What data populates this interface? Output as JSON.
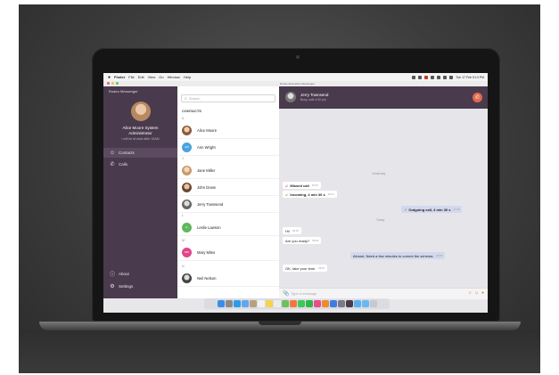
{
  "menubar": {
    "items": [
      "Finder",
      "File",
      "Edit",
      "View",
      "Go",
      "Window",
      "Help"
    ],
    "clock": "Tue 17 Feb  5:13 PM"
  },
  "window": {
    "title": "Rodeo Enterprise Messenger"
  },
  "sidebar": {
    "app_name": "Rodeo Messenger",
    "user_name_line1": "Alice Moore System",
    "user_name_line2": "Administrator",
    "user_status": "I will be at work after 10AM",
    "nav": [
      {
        "label": "Contacts",
        "icon": "person-icon"
      },
      {
        "label": "Calls",
        "icon": "phone-icon"
      }
    ],
    "bottom": [
      {
        "label": "About",
        "icon": "info-icon"
      },
      {
        "label": "Settings",
        "icon": "gear-icon"
      }
    ]
  },
  "contacts": {
    "search_placeholder": "Search",
    "header": "CONTACTS",
    "groups": [
      {
        "letter": "A",
        "items": [
          {
            "name": "Alice Moore"
          },
          {
            "name": "Ann Wright",
            "initials": "AW"
          }
        ]
      },
      {
        "letter": "J",
        "items": [
          {
            "name": "Jane Miller"
          },
          {
            "name": "John Doew"
          },
          {
            "name": "Jerry Townsend"
          }
        ]
      },
      {
        "letter": "L",
        "items": [
          {
            "name": "Leslie Lawson",
            "initials": "LL"
          }
        ]
      },
      {
        "letter": "M",
        "items": [
          {
            "name": "Mary Miles",
            "initials": "MM"
          }
        ]
      },
      {
        "letter": "N",
        "items": [
          {
            "name": "Neil Nelson"
          }
        ]
      }
    ]
  },
  "chat": {
    "contact_name": "Jerry Townsend",
    "contact_status": "Busy until 4:00 pm",
    "day_yesterday": "Yesterday",
    "day_today": "Today",
    "messages": [
      {
        "text": "Missed call",
        "time": "15:54",
        "dir": "in"
      },
      {
        "text": "Incoming, 4 min 30 s",
        "time": "16:17",
        "dir": "in"
      },
      {
        "text": "Outgoing call, 4 min 30 s",
        "time": "17:29",
        "dir": "out"
      },
      {
        "text": "Hi!",
        "time": "09:33",
        "dir": "in"
      },
      {
        "text": "Are you ready?",
        "time": "09:40",
        "dir": "in"
      },
      {
        "text": "Almost. Need a few minutes to correct the schema.",
        "time": "09:52",
        "dir": "out"
      },
      {
        "text": "OK, take your time.",
        "time": "09:57",
        "dir": "in"
      }
    ],
    "composer_placeholder": "Type a message"
  },
  "colors": {
    "sidebar": "#4a3a4d",
    "accent_call": "#e06a4e",
    "outgoing_bubble": "#d4d8ee"
  }
}
